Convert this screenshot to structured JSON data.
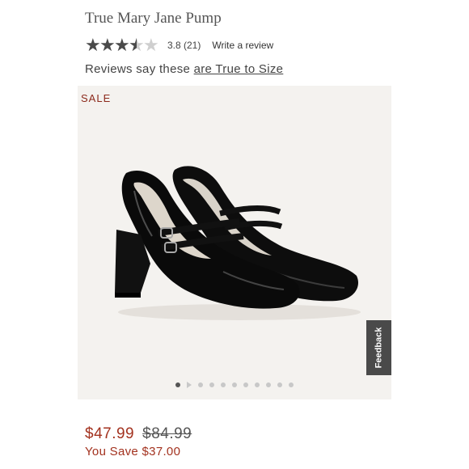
{
  "product": {
    "title": "True Mary Jane Pump",
    "rating_value": 3.8,
    "rating_text": "3.8 (21)",
    "write_review": "Write a review"
  },
  "fit": {
    "prefix": "Reviews say these ",
    "link": "are True to Size"
  },
  "gallery": {
    "badge": "SALE",
    "feedback": "Feedback",
    "image_count": 11,
    "active_index": 0
  },
  "pricing": {
    "sale_price": "$47.99",
    "original_price": "$84.99",
    "savings": "You Save $37.00"
  },
  "colors": {
    "sale_red": "#a3321f",
    "star_filled": "#4a4a4a",
    "star_empty": "#cfcfcf"
  }
}
